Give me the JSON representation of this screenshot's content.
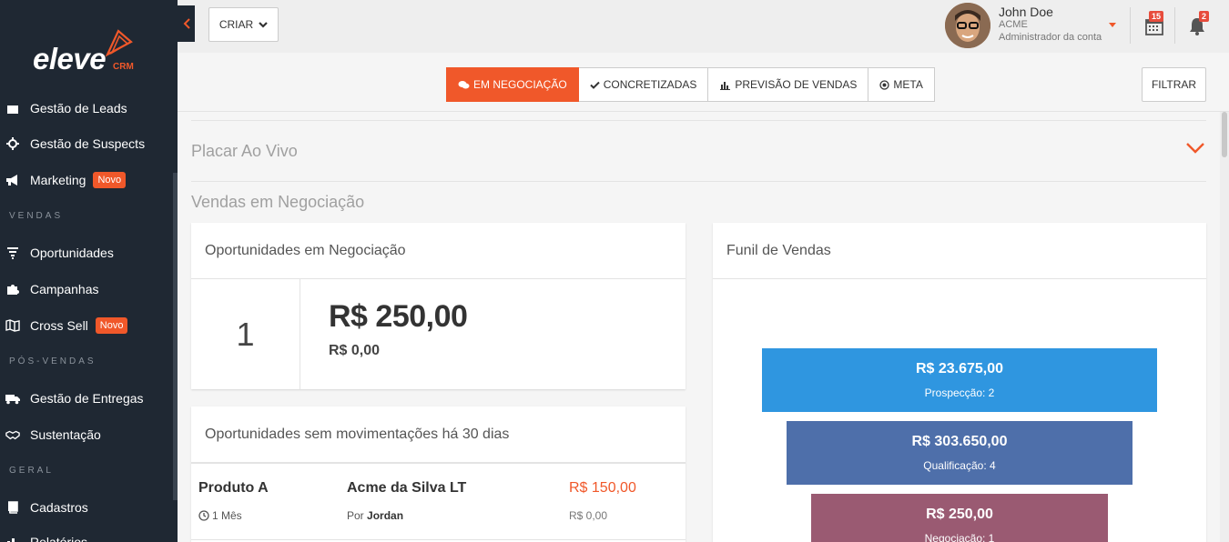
{
  "brand": {
    "logo_text": "eleve",
    "logo_sub": "CRM",
    "accent": "#f0582a",
    "sidebar_bg": "#1f2833"
  },
  "sidebar": {
    "items": [
      {
        "label": "Gestão de Leads",
        "icon": "funnel-icon"
      },
      {
        "label": "Gestão de Suspects",
        "icon": "crosshair-icon"
      },
      {
        "label": "Marketing",
        "icon": "megaphone-icon",
        "badge": "Novo"
      },
      {
        "label": "Oportunidades",
        "icon": "filter-icon"
      },
      {
        "label": "Campanhas",
        "icon": "puzzle-icon"
      },
      {
        "label": "Cross Sell",
        "icon": "map-icon",
        "badge": "Novo"
      },
      {
        "label": "Gestão de Entregas",
        "icon": "truck-icon"
      },
      {
        "label": "Sustentação",
        "icon": "handshake-icon"
      },
      {
        "label": "Cadastros",
        "icon": "book-icon"
      },
      {
        "label": "Relatórios",
        "icon": "chart-icon"
      }
    ],
    "sections": [
      "VENDAS",
      "PÓS-VENDAS",
      "GERAL"
    ]
  },
  "topbar": {
    "criar_label": "CRIAR",
    "user_name": "John Doe",
    "user_company": "ACME",
    "user_role": "Administrador da conta",
    "calendar_count": "15",
    "notification_count": "2"
  },
  "tabs": [
    {
      "label": "EM NEGOCIAÇÃO",
      "icon": "chat-icon",
      "active": true
    },
    {
      "label": "CONCRETIZADAS",
      "icon": "check-icon",
      "active": false
    },
    {
      "label": "PREVISÃO DE VENDAS",
      "icon": "bar-chart-icon",
      "active": false
    },
    {
      "label": "META",
      "icon": "target-icon",
      "active": false
    }
  ],
  "filtrar_label": "FILTRAR",
  "placar": {
    "title": "Placar Ao Vivo"
  },
  "section_title": "Vendas em Negociação",
  "negociacao_card": {
    "title": "Oportunidades em Negociação",
    "count": "1",
    "value": "R$ 250,00",
    "sub_value": "R$ 0,00"
  },
  "sem_mov_card": {
    "title": "Oportunidades sem movimentações há 30 dias",
    "rows": [
      {
        "product": "Produto A",
        "time": "1 Mês",
        "company": "Acme da Silva LT",
        "by_prefix": "Por",
        "by_name": "Jordan",
        "price": "R$ 150,00",
        "price2": "R$ 0,00"
      }
    ]
  },
  "funnel_card": {
    "title": "Funil de Vendas",
    "stages": [
      {
        "value": "R$ 23.675,00",
        "label": "Prospecção: 2",
        "color": "#2f96e0"
      },
      {
        "value": "R$ 303.650,00",
        "label": "Qualificação: 4",
        "color": "#4e6faa"
      },
      {
        "value": "R$ 250,00",
        "label": "Negociação: 1",
        "color": "#9a5a72"
      }
    ]
  }
}
